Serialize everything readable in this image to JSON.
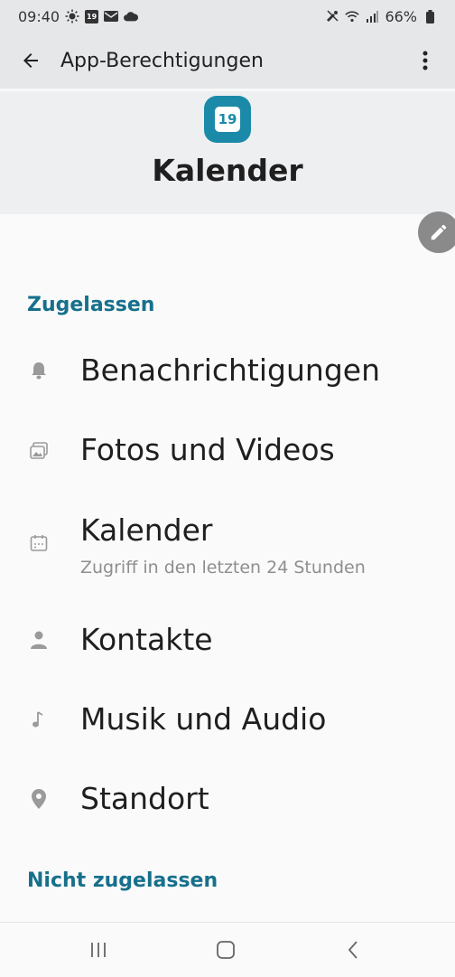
{
  "status_bar": {
    "time": "09:40",
    "calendar_badge": "19",
    "battery": "66%"
  },
  "app_bar": {
    "title": "App-Berechtigungen"
  },
  "header": {
    "app_icon_day": "19",
    "app_name": "Kalender"
  },
  "sections": {
    "allowed_title": "Zugelassen",
    "denied_title": "Nicht zugelassen"
  },
  "permissions": [
    {
      "label": "Benachrichtigungen",
      "icon": "bell-icon"
    },
    {
      "label": "Fotos und Videos",
      "icon": "image-icon"
    },
    {
      "label": "Kalender",
      "icon": "calendar-icon",
      "subtitle": "Zugriff in den letzten 24 Stunden"
    },
    {
      "label": "Kontakte",
      "icon": "person-icon"
    },
    {
      "label": "Musik und Audio",
      "icon": "music-note-icon"
    },
    {
      "label": "Standort",
      "icon": "location-pin-icon"
    }
  ],
  "colors": {
    "accent": "#16708c",
    "app_icon": "#1b8aa8",
    "header_bg": "#eeeff1"
  }
}
